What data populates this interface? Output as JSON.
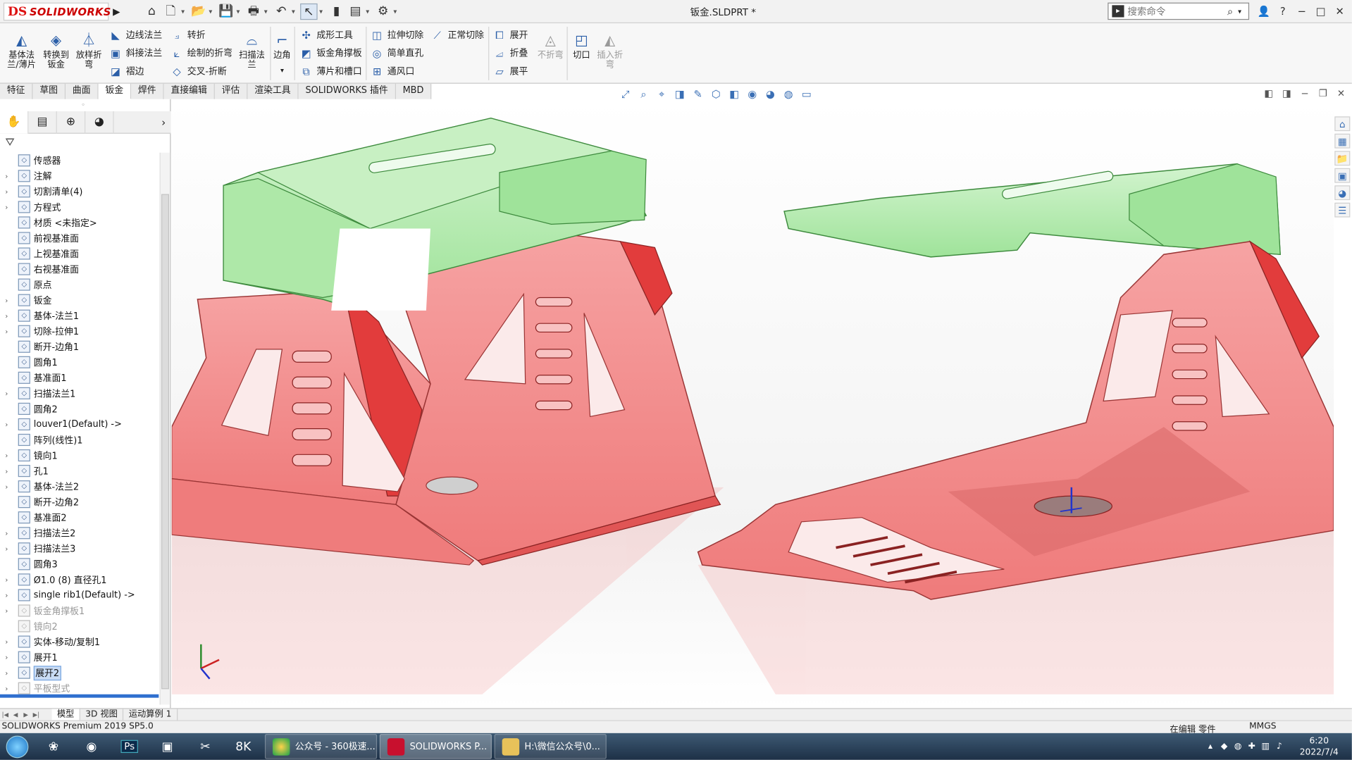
{
  "titlebar": {
    "logo_ds": "DS",
    "logo_name": "SOLIDWORKS",
    "doc_title": "钣金.SLDPRT *",
    "search_placeholder": "搜索命令",
    "win_buttons": [
      "?",
      "−",
      "□",
      "✕"
    ]
  },
  "ribbon": {
    "big_buttons": [
      "基体法兰/薄片",
      "转换到钣金",
      "放样折弯",
      "扫描法兰",
      "边角",
      "切口",
      "插入折弯"
    ],
    "col1": [
      "边线法兰",
      "斜接法兰",
      "褶边"
    ],
    "col2": [
      "转折",
      "绘制的折弯",
      "交叉-折断"
    ],
    "col3": [
      "成形工具",
      "钣金角撑板",
      "薄片和槽口"
    ],
    "col4": [
      "拉伸切除",
      "简单直孔",
      "通风口"
    ],
    "col5": [
      "正常切除"
    ],
    "col6": [
      "展开",
      "折叠",
      "展平"
    ],
    "no_bend": "不折弯"
  },
  "tabs": [
    "特征",
    "草图",
    "曲面",
    "钣金",
    "焊件",
    "直接编辑",
    "评估",
    "渲染工具",
    "SOLIDWORKS 插件",
    "MBD"
  ],
  "tree": [
    {
      "label": "传感器",
      "icon": "sensor-icon"
    },
    {
      "label": "注解",
      "icon": "annotation-icon"
    },
    {
      "label": "切割清单(4)",
      "icon": "cutlist-icon"
    },
    {
      "label": "方程式",
      "icon": "equation-icon"
    },
    {
      "label": "材质 <未指定>",
      "icon": "material-icon"
    },
    {
      "label": "前视基准面",
      "icon": "plane-icon"
    },
    {
      "label": "上视基准面",
      "icon": "plane-icon"
    },
    {
      "label": "右视基准面",
      "icon": "plane-icon"
    },
    {
      "label": "原点",
      "icon": "origin-icon"
    },
    {
      "label": "钣金",
      "icon": "sheetmetal-icon"
    },
    {
      "label": "基体-法兰1",
      "icon": "flange-icon"
    },
    {
      "label": "切除-拉伸1",
      "icon": "cut-icon"
    },
    {
      "label": "断开-边角1",
      "icon": "corner-icon"
    },
    {
      "label": "圆角1",
      "icon": "fillet-icon"
    },
    {
      "label": "基准面1",
      "icon": "plane-icon"
    },
    {
      "label": "扫描法兰1",
      "icon": "swept-flange-icon"
    },
    {
      "label": "圆角2",
      "icon": "fillet-icon"
    },
    {
      "label": "louver1(Default) ->",
      "icon": "louver-icon"
    },
    {
      "label": "阵列(线性)1",
      "icon": "pattern-icon"
    },
    {
      "label": "镜向1",
      "icon": "mirror-icon"
    },
    {
      "label": "孔1",
      "icon": "hole-icon"
    },
    {
      "label": "基体-法兰2",
      "icon": "flange-icon"
    },
    {
      "label": "断开-边角2",
      "icon": "corner-icon"
    },
    {
      "label": "基准面2",
      "icon": "plane-icon"
    },
    {
      "label": "扫描法兰2",
      "icon": "swept-flange-icon"
    },
    {
      "label": "扫描法兰3",
      "icon": "swept-flange-icon"
    },
    {
      "label": "圆角3",
      "icon": "fillet-icon"
    },
    {
      "label": "Ø1.0 (8) 直径孔1",
      "icon": "hole-wizard-icon"
    },
    {
      "label": "single rib1(Default) ->",
      "icon": "rib-icon"
    },
    {
      "label": "钣金角撑板1",
      "icon": "gusset-icon"
    },
    {
      "label": "镜向2",
      "icon": "mirror-icon"
    },
    {
      "label": "实体-移动/复制1",
      "icon": "move-body-icon"
    },
    {
      "label": "展开1",
      "icon": "unfold-icon"
    },
    {
      "label": "展开2",
      "icon": "unfold-icon"
    },
    {
      "label": "平板型式",
      "icon": "flat-pattern-icon"
    }
  ],
  "bottom_tabs": [
    "模型",
    "3D 视图",
    "运动算例 1"
  ],
  "status": {
    "left": "SOLIDWORKS Premium 2019 SP5.0",
    "mode": "在编辑 零件",
    "units": "MMGS"
  },
  "taskbar": {
    "tasks": [
      "公众号 - 360极速...",
      "SOLIDWORKS P...",
      "H:\\微信公众号\\0..."
    ],
    "time": "6:20",
    "date": "2022/7/4"
  },
  "colors": {
    "part_red": "#f28b8b",
    "part_green": "#aeeaa8",
    "accent": "#2a5ea8"
  }
}
